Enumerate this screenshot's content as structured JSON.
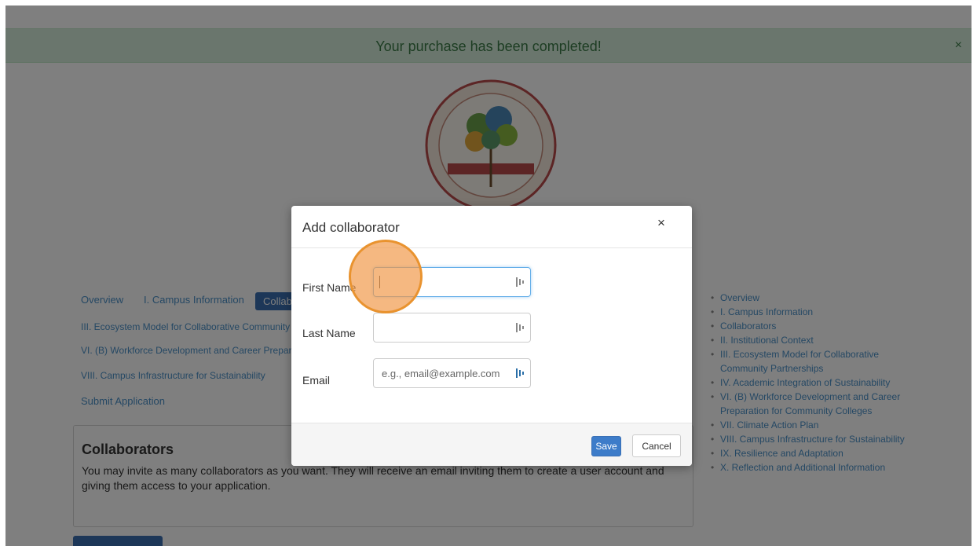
{
  "banner": {
    "message": "Your purchase has been completed!",
    "close_glyph": "×"
  },
  "tabs": {
    "overview": "Overview",
    "campus_info": "I. Campus Information",
    "collaborators": "Collaborators"
  },
  "nav_lines": {
    "line1": "III. Ecosystem Model for Collaborative Community Partnerships",
    "line2": "VI. (B) Workforce Development and Career Preparation for Community Colleges",
    "line3": "VIII. Campus Infrastructure for Sustainability",
    "submit": "Submit Application"
  },
  "panel": {
    "title": "Collaborators",
    "description": "You may invite as many collaborators as you want. They will receive an email inviting them to create a user account and giving them access to your application."
  },
  "side_list": [
    "Overview",
    "I. Campus Information",
    "Collaborators",
    "II. Institutional Context",
    "III. Ecosystem Model for Collaborative Community Partnerships",
    "IV. Academic Integration of Sustainability",
    "VI. (B) Workforce Development and Career Preparation for Community Colleges",
    "VII. Climate Action Plan",
    "VIII. Campus Infrastructure for Sustainability",
    "IX. Resilience and Adaptation",
    "X. Reflection and Additional Information"
  ],
  "modal": {
    "title": "Add collaborator",
    "close_glyph": "×",
    "first_name_label": "First Name",
    "last_name_label": "Last Name",
    "email_label": "Email",
    "first_name_value": "",
    "last_name_value": "",
    "email_placeholder": "e.g., email@example.com",
    "save_label": "Save",
    "cancel_label": "Cancel"
  },
  "icons": {
    "field_icon": "password-manager-icon",
    "click_marker": "click-indicator"
  },
  "colors": {
    "banner_bg": "#d4edda",
    "banner_text": "#3a7a46",
    "primary_button": "#3d7cc9",
    "click_marker": "#e9932f"
  }
}
